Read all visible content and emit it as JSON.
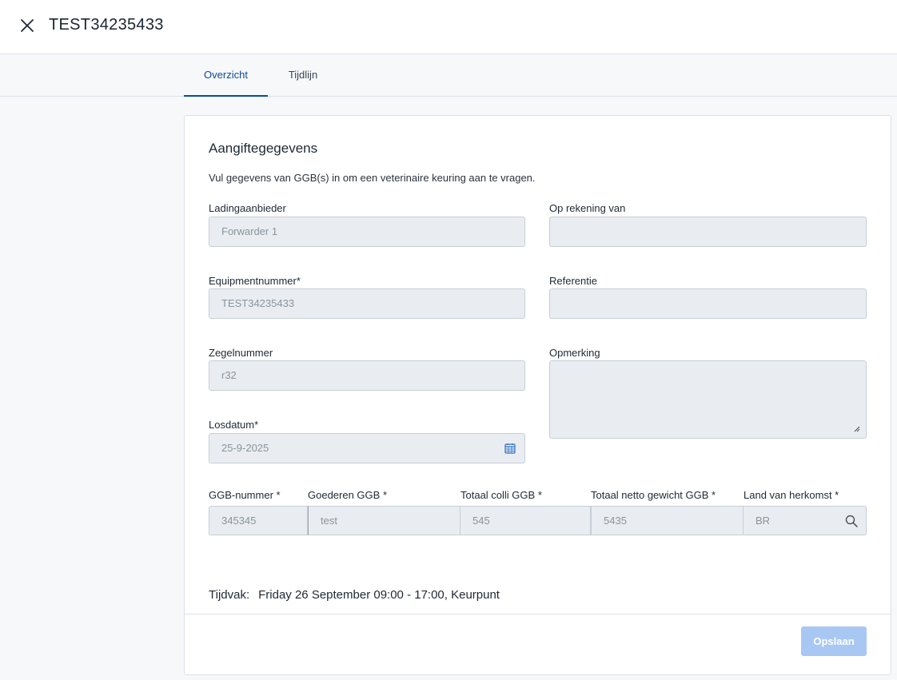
{
  "header": {
    "title": "TEST34235433"
  },
  "tabs": [
    {
      "label": "Overzicht",
      "active": true
    },
    {
      "label": "Tijdlijn",
      "active": false
    }
  ],
  "card": {
    "title": "Aangiftegegevens",
    "subtitle": "Vul gegevens van GGB(s) in om een veterinaire keuring aan te vragen."
  },
  "form": {
    "ladingaanbieder": {
      "label": "Ladingaanbieder",
      "value": "Forwarder 1"
    },
    "op_rekening_van": {
      "label": "Op rekening van",
      "value": ""
    },
    "equipmentnummer": {
      "label": "Equipmentnummer*",
      "value": "TEST34235433"
    },
    "referentie": {
      "label": "Referentie",
      "value": ""
    },
    "zegelnummer": {
      "label": "Zegelnummer",
      "value": "r32"
    },
    "opmerking": {
      "label": "Opmerking",
      "value": ""
    },
    "losdatum": {
      "label": "Losdatum*",
      "value": "25-9-2025"
    }
  },
  "ggb": {
    "headers": [
      "GGB-nummer *",
      "Goederen GGB *",
      "Totaal colli GGB *",
      "Totaal netto gewicht GGB *",
      "Land van herkomst *"
    ],
    "values": [
      "345345",
      "test",
      "545",
      "5435",
      "BR"
    ]
  },
  "tijdvak": {
    "label": "Tijdvak:",
    "value": "Friday 26 September 09:00 - 17:00, Keurpunt"
  },
  "actions": {
    "save_label": "Opslaan"
  },
  "colors": {
    "accent": "#0b4a9a",
    "button_disabled": "#a8c8f3",
    "field_bg": "#e9edf1"
  }
}
